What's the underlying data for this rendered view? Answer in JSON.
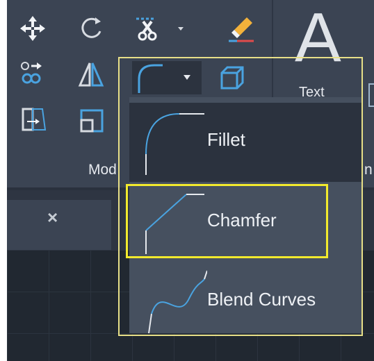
{
  "ribbon": {
    "panel_label": "Mod",
    "text_tool": {
      "glyph": "A",
      "label": "Text"
    },
    "right_edge_label": "n",
    "tools": [
      {
        "name": "move-icon"
      },
      {
        "name": "rotate-icon"
      },
      {
        "name": "trim-icon"
      },
      {
        "name": "erase-icon"
      },
      {
        "name": "copy-icon"
      },
      {
        "name": "mirror-icon"
      },
      {
        "name": "fillet-icon"
      },
      {
        "name": "explode-icon"
      },
      {
        "name": "stretch-icon"
      },
      {
        "name": "scale-icon"
      }
    ]
  },
  "dropdown": {
    "items": [
      {
        "label": "Fillet",
        "icon": "fillet-icon",
        "selected": true
      },
      {
        "label": "Chamfer",
        "icon": "chamfer-icon",
        "highlighted": true
      },
      {
        "label": "Blend Curves",
        "icon": "blend-curves-icon"
      }
    ]
  },
  "tabs": {
    "close_glyph": "×"
  },
  "colors": {
    "ribbon_bg": "#3b4453",
    "menu_bg": "#46505f",
    "selected_bg": "#2b323e",
    "accent_blue": "#4aa3e0",
    "highlight_yellow": "#f2ea2d",
    "outline_yellow": "#e8e088"
  }
}
